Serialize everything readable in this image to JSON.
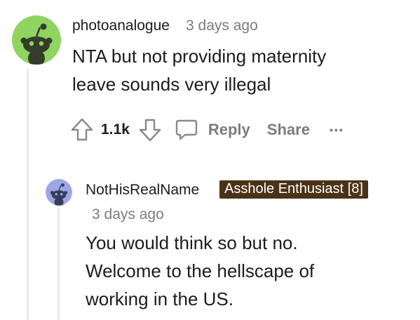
{
  "comment": {
    "username": "photoanalogue",
    "time": "3 days ago",
    "body_lines": [
      "NTA but not providing maternity",
      "leave sounds very illegal"
    ],
    "vote_count": "1.1k",
    "reply_label": "Reply",
    "share_label": "Share",
    "more_label": "•••",
    "avatar_color": "#8fd461"
  },
  "reply": {
    "username": "NotHisRealName",
    "flair": "Asshole Enthusiast [8]",
    "flair_color": "#4a3218",
    "time": "3 days ago",
    "body_lines": [
      "You would think so but no.",
      "Welcome to the hellscape of",
      "working in the US."
    ],
    "avatar_color": "#9fa6e6"
  }
}
